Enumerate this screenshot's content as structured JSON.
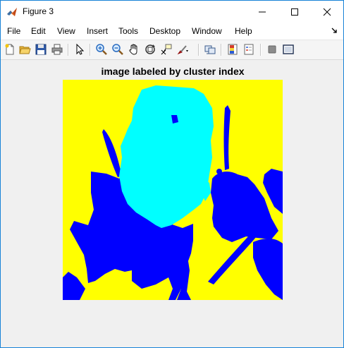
{
  "window": {
    "title": "Figure 3",
    "accent_color": "#1883d7",
    "controls": [
      "minimize-icon",
      "maximize-icon",
      "close-icon"
    ]
  },
  "menu": {
    "items": [
      {
        "label": "File"
      },
      {
        "label": "Edit"
      },
      {
        "label": "View"
      },
      {
        "label": "Insert"
      },
      {
        "label": "Tools"
      },
      {
        "label": "Desktop"
      },
      {
        "label": "Window"
      },
      {
        "label": "Help"
      }
    ]
  },
  "toolbar": {
    "buttons": [
      "new-figure-icon",
      "open-file-icon",
      "save-icon",
      "print-icon",
      "edit-plot-arrow-icon",
      "zoom-in-icon",
      "zoom-out-icon",
      "pan-hand-icon",
      "rotate-3d-icon",
      "data-cursor-icon",
      "brush-icon",
      "link-plot-icon",
      "insert-colorbar-icon",
      "insert-legend-icon",
      "hide-plot-tools-icon",
      "show-plot-tools-icon"
    ]
  },
  "figure": {
    "axes_title": "image labeled by cluster index",
    "colors": {
      "background": "#ffff00",
      "cluster_blue": "#0000ff",
      "cluster_cyan": "#00ffff"
    }
  }
}
